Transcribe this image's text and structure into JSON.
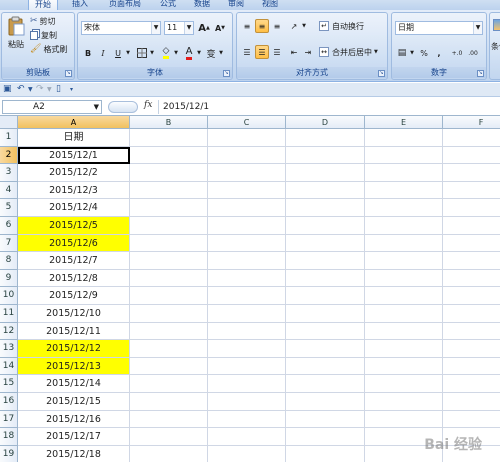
{
  "tabs": [
    "开始",
    "插入",
    "页面布局",
    "公式",
    "数据",
    "审阅",
    "视图"
  ],
  "clipboard": {
    "paste": "粘贴",
    "cut": "剪切",
    "copy": "复制",
    "format_painter": "格式刷",
    "label": "剪贴板"
  },
  "font": {
    "name": "宋体",
    "size": "11",
    "grow": "A",
    "shrink": "A",
    "bold": "B",
    "italic": "I",
    "underline": "U",
    "color_letter": "A",
    "phonetic": "变",
    "label": "字体"
  },
  "alignment": {
    "wrap_text": "自动换行",
    "merge_center": "合并后居中",
    "label": "对齐方式"
  },
  "number": {
    "format": "日期",
    "percent": "%",
    "comma": ",",
    "label": "数字"
  },
  "extra": {
    "label": "条件"
  },
  "formula_bar": {
    "name_box": "A2",
    "fx": "fx",
    "value": "2015/12/1"
  },
  "grid": {
    "columns": [
      "A",
      "B",
      "C",
      "D",
      "E",
      "F"
    ],
    "selected_column": "A",
    "active_row": 2,
    "rows": [
      {
        "n": "1",
        "a": "日期",
        "highlight": false
      },
      {
        "n": "2",
        "a": "2015/12/1",
        "highlight": false
      },
      {
        "n": "3",
        "a": "2015/12/2",
        "highlight": false
      },
      {
        "n": "4",
        "a": "2015/12/3",
        "highlight": false
      },
      {
        "n": "5",
        "a": "2015/12/4",
        "highlight": false
      },
      {
        "n": "6",
        "a": "2015/12/5",
        "highlight": true
      },
      {
        "n": "7",
        "a": "2015/12/6",
        "highlight": true
      },
      {
        "n": "8",
        "a": "2015/12/7",
        "highlight": false
      },
      {
        "n": "9",
        "a": "2015/12/8",
        "highlight": false
      },
      {
        "n": "10",
        "a": "2015/12/9",
        "highlight": false
      },
      {
        "n": "11",
        "a": "2015/12/10",
        "highlight": false
      },
      {
        "n": "12",
        "a": "2015/12/11",
        "highlight": false
      },
      {
        "n": "13",
        "a": "2015/12/12",
        "highlight": true
      },
      {
        "n": "14",
        "a": "2015/12/13",
        "highlight": true
      },
      {
        "n": "15",
        "a": "2015/12/14",
        "highlight": false
      },
      {
        "n": "16",
        "a": "2015/12/15",
        "highlight": false
      },
      {
        "n": "17",
        "a": "2015/12/16",
        "highlight": false
      },
      {
        "n": "18",
        "a": "2015/12/17",
        "highlight": false
      },
      {
        "n": "19",
        "a": "2015/12/18",
        "highlight": false
      }
    ]
  },
  "colors": {
    "highlight": "#ffff00",
    "selected_header": "#f1c15f",
    "gridline": "#d0d7e5"
  },
  "watermark": "Bai 经验"
}
